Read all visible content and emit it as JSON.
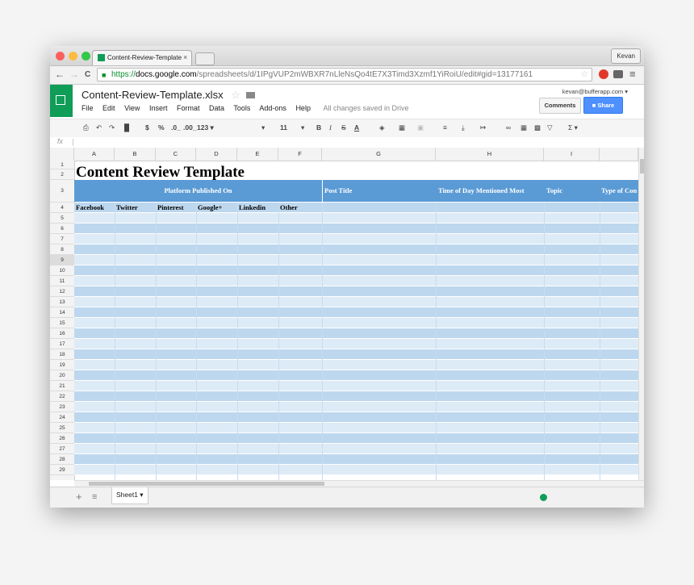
{
  "browser": {
    "tab_title": "Content-Review-Template",
    "tab_close": "×",
    "user": "Kevan",
    "url_scheme": "https://",
    "url_host": "docs.google.com",
    "url_path": "/spreadsheets/d/1IPgVUP2mWBXR7nLleNsQo4tE7X3Timd3Xzmf1YiRoiU/edit#gid=13177161",
    "back": "←",
    "forward": "→",
    "reload": "C",
    "star": "☆"
  },
  "app": {
    "doc_title": "Content-Review-Template.xlsx",
    "title_star": "☆",
    "menu": [
      "File",
      "Edit",
      "View",
      "Insert",
      "Format",
      "Data",
      "Tools",
      "Add-ons",
      "Help"
    ],
    "saved_status": "All changes saved in Drive",
    "account_email": "kevan@bufferapp.com ▾",
    "comments_label": "Comments",
    "share_label": "Share"
  },
  "toolbar": {
    "currency": "$",
    "percent": "%",
    "dec_less": ".0_",
    "dec_more": ".00_",
    "format_more": "123 ▾",
    "font_size": "11",
    "bold": "B",
    "italic": "I",
    "strike": "S",
    "text_color": "A",
    "sum": "Σ ▾"
  },
  "formula_bar": {
    "fx": "fx"
  },
  "sheet": {
    "columns": [
      "A",
      "B",
      "C",
      "D",
      "E",
      "F",
      "G",
      "H",
      "I",
      ""
    ],
    "rows": [
      "1",
      "2",
      "3",
      "4",
      "5",
      "6",
      "7",
      "8",
      "9",
      "10",
      "11",
      "12",
      "13",
      "14",
      "15",
      "16",
      "17",
      "18",
      "19",
      "20",
      "21",
      "22",
      "23",
      "24",
      "25",
      "26",
      "27",
      "28",
      "29"
    ],
    "title": "Content Review Template",
    "header_platform": "Platform Published On",
    "header_post_title": "Post Title",
    "header_time": "Time of Day Mentioned Most",
    "header_topic": "Topic",
    "header_type": "Type of Con",
    "platforms": [
      "Facebook",
      "Twitter",
      "Pinterest",
      "Google+",
      "Linkedin",
      "Other"
    ],
    "band_colors": {
      "dark": "#bdd7ee",
      "light": "#ddebf7",
      "header": "#5b9bd5"
    }
  },
  "footer": {
    "add": "+",
    "all_sheets": "≡",
    "sheet_name": "Sheet1 ▾"
  }
}
